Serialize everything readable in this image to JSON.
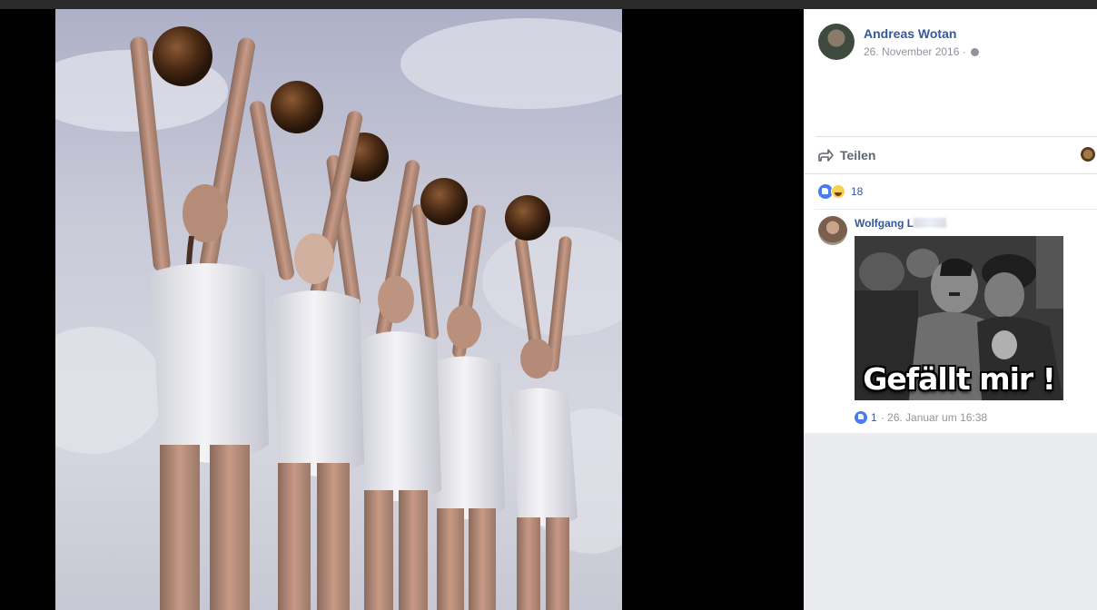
{
  "post": {
    "author": "Andreas Wotan",
    "date": "26. November 2016 ·",
    "privacy_icon": "globe-icon"
  },
  "actions": {
    "share_label": "Teilen",
    "share_icon": "share-arrow-icon"
  },
  "reactions": {
    "icons": [
      "like-icon",
      "haha-icon"
    ],
    "count": "18"
  },
  "comment": {
    "author": "Wolfgang L",
    "author_blurred": true,
    "image_caption": "Gefällt mir !",
    "like_count": "1",
    "time": "· 26. Januar um 16:38"
  },
  "colors": {
    "link_blue": "#365899",
    "meta_gray": "#90949c",
    "like_blue": "#4b7bec",
    "background": "#000000"
  }
}
